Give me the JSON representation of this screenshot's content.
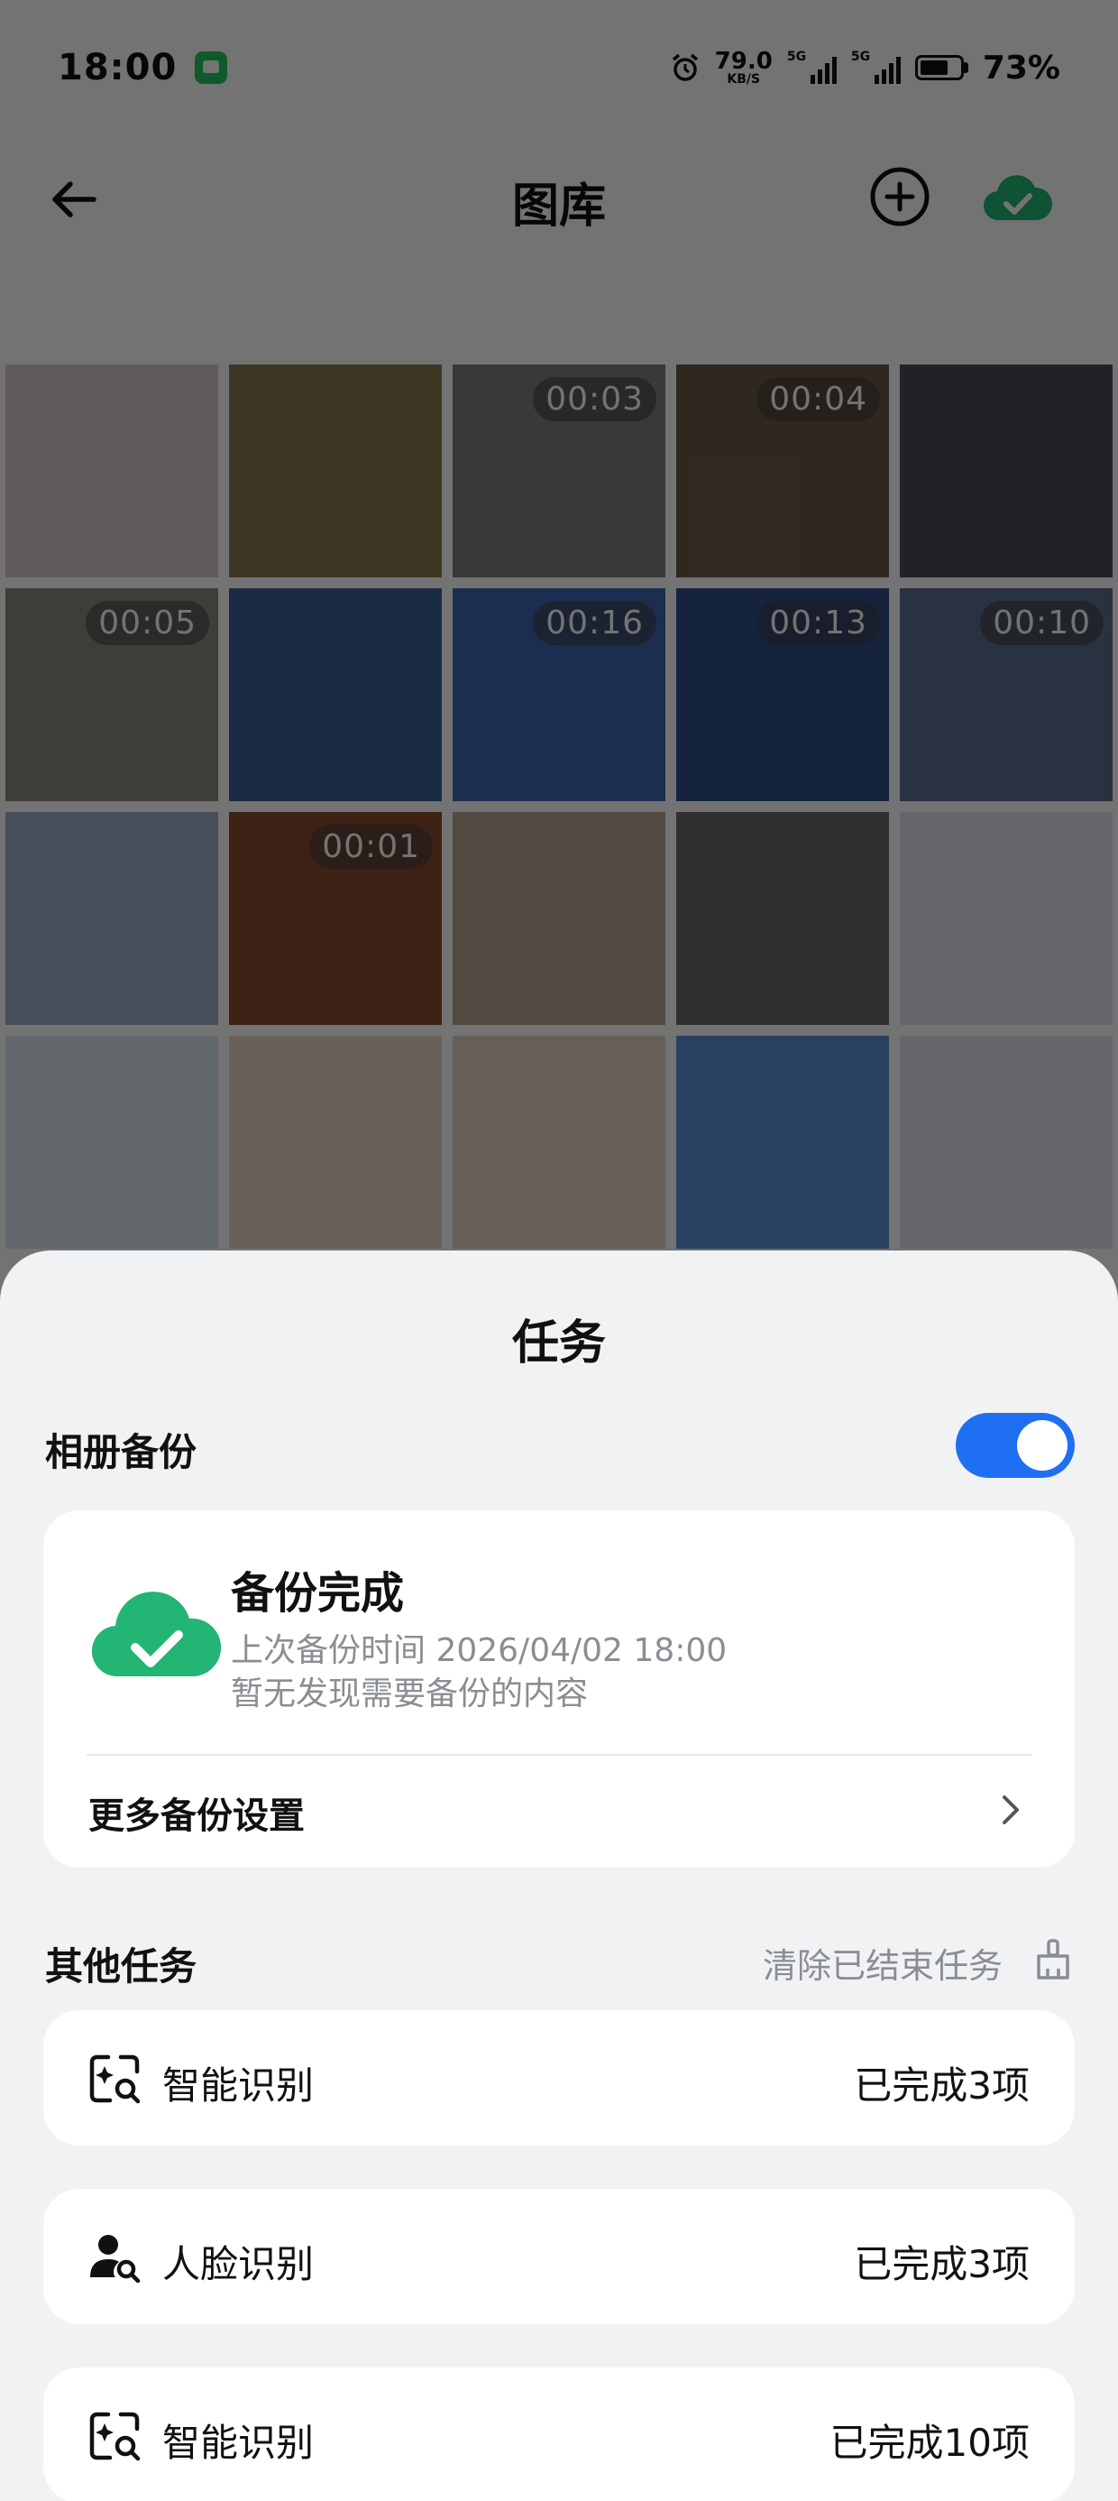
{
  "status_bar": {
    "time": "18:00",
    "net_speed_value": "79.0",
    "net_speed_unit": "KB/S",
    "sim1_label": "5G",
    "sim2_label": "5G",
    "battery_percent": "73%",
    "battery_level": 0.73
  },
  "header": {
    "title": "图库"
  },
  "gallery": {
    "tiles": [
      {
        "color": "#d8c9cd",
        "duration": ""
      },
      {
        "color": "#8c7a55",
        "duration": ""
      },
      {
        "color": "#7c7e80",
        "duration": "00:03"
      },
      {
        "color": "#6b5a45",
        "duration": "00:04"
      },
      {
        "color": "#4a4c52",
        "duration": ""
      },
      {
        "color": "#8a8880",
        "duration": "00:05"
      },
      {
        "color": "#3e5f9a",
        "duration": ""
      },
      {
        "color": "#3f66b0",
        "duration": "00:16"
      },
      {
        "color": "#2f4f8c",
        "duration": "00:13"
      },
      {
        "color": "#5c6f8e",
        "duration": "00:10"
      },
      {
        "color": "#9db0c7",
        "duration": ""
      },
      {
        "color": "#8a4a30",
        "duration": "00:01"
      },
      {
        "color": "#b6a690",
        "duration": ""
      },
      {
        "color": "#6a6c6e",
        "duration": ""
      },
      {
        "color": "#dfe3ea",
        "duration": ""
      },
      {
        "color": "#d9e4ef",
        "duration": ""
      },
      {
        "color": "#e8d6c6",
        "duration": ""
      },
      {
        "color": "#e2d4c0",
        "duration": ""
      },
      {
        "color": "#5e8fd6",
        "duration": ""
      },
      {
        "color": "#e0e3e8",
        "duration": ""
      }
    ]
  },
  "sheet": {
    "title": "任务",
    "album_backup": {
      "label": "相册备份",
      "enabled": true,
      "status_title": "备份完成",
      "last_backup": "上次备份时间 2026/04/02 18:00",
      "note": "暂无发现需要备份的内容",
      "more_settings": "更多备份设置"
    },
    "other_tasks": {
      "label": "其他任务",
      "clear_label": "清除已结束任务",
      "items": [
        {
          "name": "智能识别",
          "status": "已完成3项",
          "icon": "smart-recognition-icon"
        },
        {
          "name": "人脸识别",
          "status": "已完成3项",
          "icon": "face-recognition-icon"
        },
        {
          "name": "智能识别",
          "status": "已完成10项",
          "icon": "smart-recognition-icon"
        }
      ]
    }
  },
  "colors": {
    "accent": "#1f6ff2",
    "success_green": "#22b573",
    "sheet_bg": "#f1f2f4",
    "muted_text": "#8a8d92"
  }
}
